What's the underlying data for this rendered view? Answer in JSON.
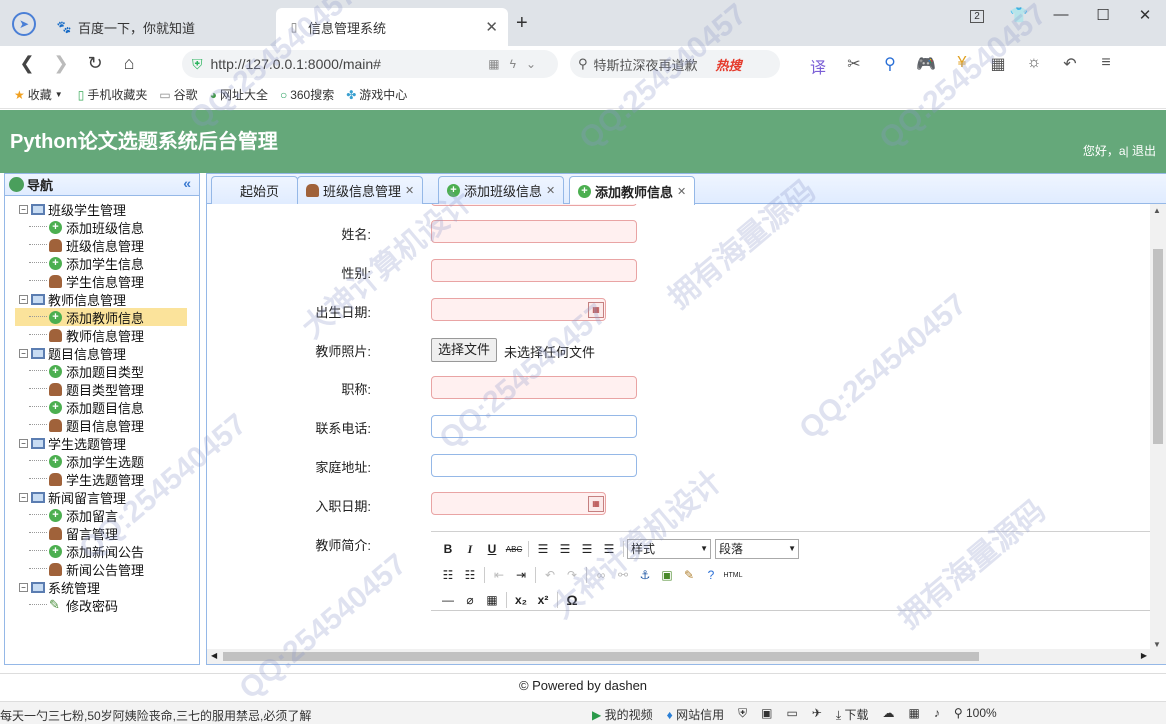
{
  "browser": {
    "tabs": [
      {
        "title": "百度一下，你就知道",
        "icon": "baidu-paw-icon"
      },
      {
        "title": "信息管理系统",
        "icon": "page-icon"
      }
    ],
    "new_tab": "+",
    "url": "http://127.0.0.1:8000/main#",
    "search_text": "特斯拉深夜再道歉",
    "search_badge": "热搜",
    "tab_count": "2",
    "bookmarks": [
      {
        "label": "收藏",
        "icon": "star-icon"
      },
      {
        "label": "手机收藏夹",
        "icon": "phone-icon"
      },
      {
        "label": "谷歌",
        "icon": "page-icon"
      },
      {
        "label": "网址大全",
        "icon": "globe-icon"
      },
      {
        "label": "360搜索",
        "icon": "search-ring-icon"
      },
      {
        "label": "游戏中心",
        "icon": "gamepad-icon"
      }
    ]
  },
  "app": {
    "title": "Python论文选题系统后台管理",
    "greeting": "您好，a| 退出",
    "nav_title": "导航",
    "tree": [
      {
        "label": "班级学生管理",
        "type": "group"
      },
      {
        "label": "添加班级信息",
        "type": "add"
      },
      {
        "label": "班级信息管理",
        "type": "user"
      },
      {
        "label": "添加学生信息",
        "type": "add"
      },
      {
        "label": "学生信息管理",
        "type": "user"
      },
      {
        "label": "教师信息管理",
        "type": "group"
      },
      {
        "label": "添加教师信息",
        "type": "add",
        "selected": true
      },
      {
        "label": "教师信息管理",
        "type": "user"
      },
      {
        "label": "题目信息管理",
        "type": "group"
      },
      {
        "label": "添加题目类型",
        "type": "add"
      },
      {
        "label": "题目类型管理",
        "type": "user"
      },
      {
        "label": "添加题目信息",
        "type": "add"
      },
      {
        "label": "题目信息管理",
        "type": "user"
      },
      {
        "label": "学生选题管理",
        "type": "group"
      },
      {
        "label": "添加学生选题",
        "type": "add"
      },
      {
        "label": "学生选题管理",
        "type": "user"
      },
      {
        "label": "新闻留言管理",
        "type": "group"
      },
      {
        "label": "添加留言",
        "type": "add"
      },
      {
        "label": "留言管理",
        "type": "user"
      },
      {
        "label": "添加新闻公告",
        "type": "add"
      },
      {
        "label": "新闻公告管理",
        "type": "user"
      },
      {
        "label": "系统管理",
        "type": "group"
      },
      {
        "label": "修改密码",
        "type": "pen"
      }
    ],
    "page_tabs": [
      {
        "label": "起始页",
        "icon": "",
        "closable": false
      },
      {
        "label": "班级信息管理",
        "icon": "user",
        "closable": true
      },
      {
        "label": "添加班级信息",
        "icon": "add",
        "closable": true
      },
      {
        "label": "添加教师信息",
        "icon": "add",
        "closable": true,
        "active": true
      }
    ],
    "form": {
      "name_label": "姓名:",
      "gender_label": "性别:",
      "birth_label": "出生日期:",
      "photo_label": "教师照片:",
      "file_button": "选择文件",
      "file_status": "未选择任何文件",
      "title_label": "职称:",
      "phone_label": "联系电话:",
      "address_label": "家庭地址:",
      "join_label": "入职日期:",
      "intro_label": "教师简介:"
    },
    "editor": {
      "style_select": "样式",
      "format_select": "段落",
      "html_btn": "HTML"
    },
    "footer": "© Powered by dashen"
  },
  "statusbar": {
    "news": "每天一勺三七粉,50岁阿姨险丧命,三七的服用禁忌,必须了解",
    "video": "我的视频",
    "credit": "网站信用",
    "download": "下载",
    "zoom": "100%"
  },
  "watermarks": [
    "QQ:254540457",
    "大神计算机设计",
    "拥有海量源码"
  ]
}
